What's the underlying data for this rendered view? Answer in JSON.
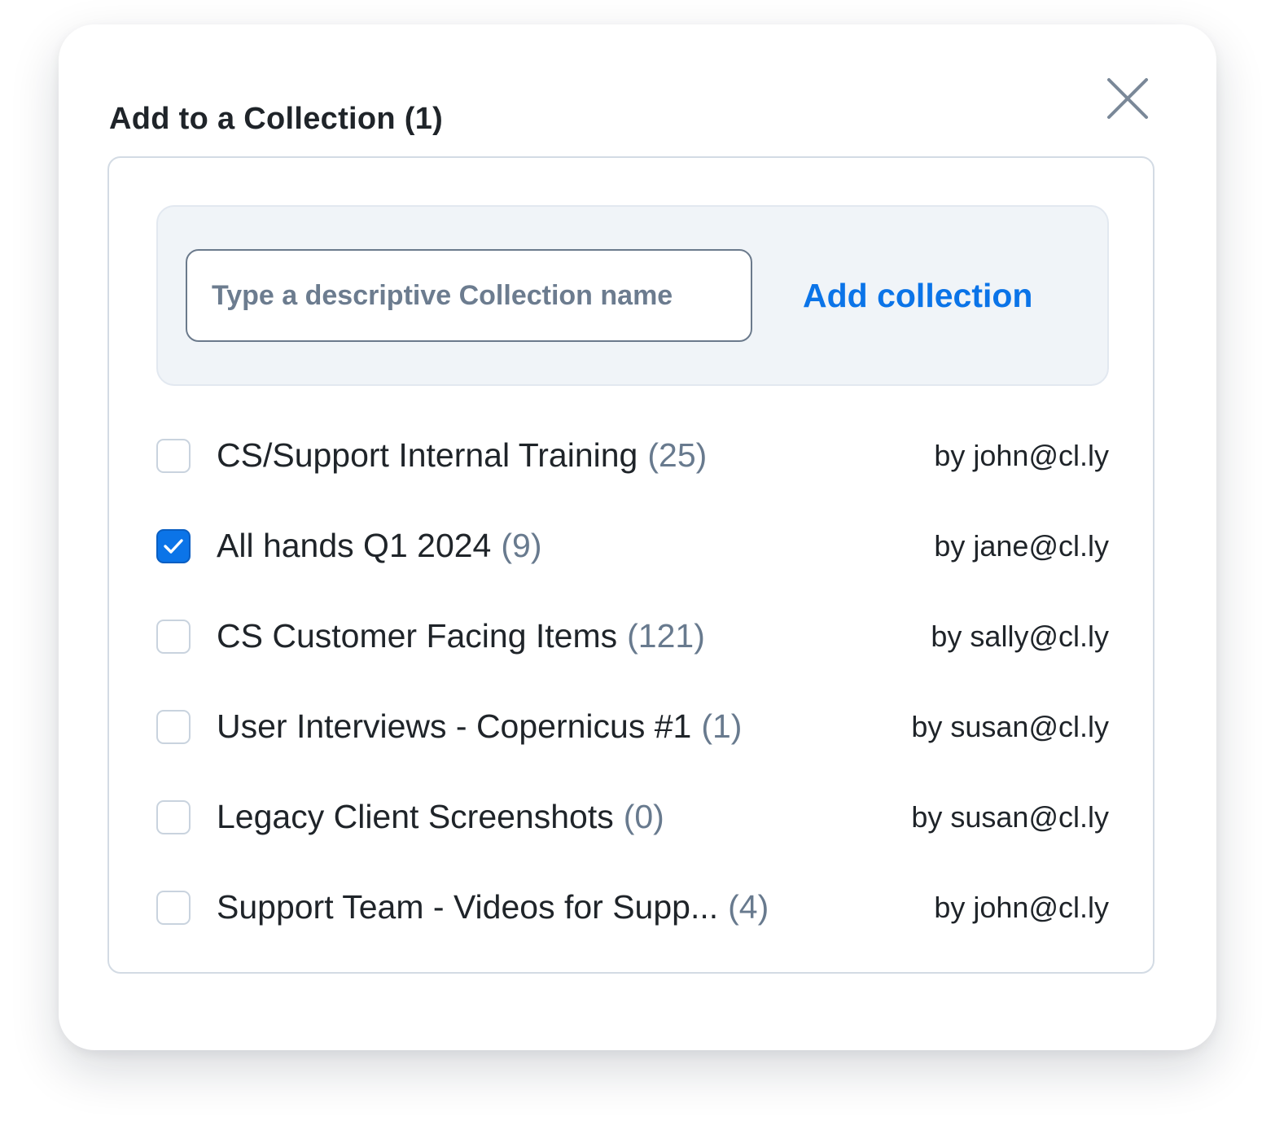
{
  "dialog": {
    "title": "Add to a Collection (1)",
    "close_icon": "close-icon"
  },
  "new_collection": {
    "input_value": "",
    "input_placeholder": "Type a descriptive Collection name",
    "add_label": "Add collection"
  },
  "collections": [
    {
      "name": "CS/Support Internal Training",
      "count": "(25)",
      "owner": "by john@cl.ly",
      "checked": false
    },
    {
      "name": "All hands Q1 2024",
      "count": "(9)",
      "owner": "by jane@cl.ly",
      "checked": true
    },
    {
      "name": "CS Customer Facing Items",
      "count": "(121)",
      "owner": "by sally@cl.ly",
      "checked": false
    },
    {
      "name": "User Interviews - Copernicus #1",
      "count": "(1)",
      "owner": "by susan@cl.ly",
      "checked": false
    },
    {
      "name": "Legacy Client Screenshots",
      "count": "(0)",
      "owner": "by susan@cl.ly",
      "checked": false
    },
    {
      "name": "Support Team - Videos for Supp...",
      "count": "(4)",
      "owner": "by john@cl.ly",
      "checked": false
    }
  ],
  "colors": {
    "accent": "#0b74e8",
    "text": "#1f2429",
    "muted": "#687a8e",
    "border": "#d3dbe4",
    "panel_bg": "#f0f4f8"
  }
}
